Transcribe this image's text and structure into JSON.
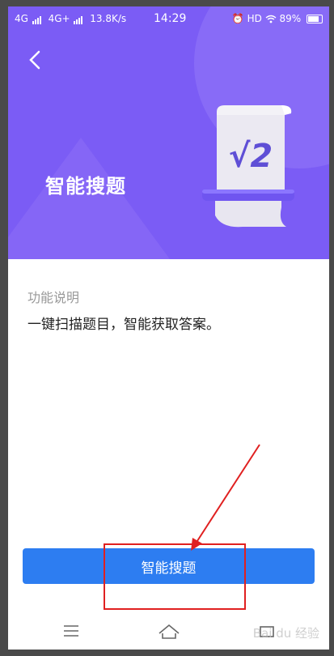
{
  "status_bar": {
    "network1": "4G",
    "network2": "4G+",
    "speed": "13.8K/s",
    "time": "14:29",
    "hd": "HD",
    "battery": "89%"
  },
  "header": {
    "title": "智能搜题",
    "illustration_text": "√2"
  },
  "content": {
    "section_label": "功能说明",
    "description": "一键扫描题目，智能获取答案。"
  },
  "action_button": {
    "label": "智能搜题"
  },
  "watermark": "Bai du 经验",
  "colors": {
    "header_bg": "#7b5cf5",
    "button_bg": "#2d7df1",
    "annotation": "#e02020"
  }
}
